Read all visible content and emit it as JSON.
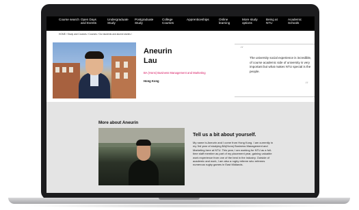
{
  "nav": {
    "items": [
      {
        "label": "Course search"
      },
      {
        "label": "Open Days and Events"
      },
      {
        "label": "Undergraduate Study"
      },
      {
        "label": "Postgraduate Study"
      },
      {
        "label": "College Courses"
      },
      {
        "label": "Apprenticeships"
      },
      {
        "label": "Online learning"
      },
      {
        "label": "More study options"
      },
      {
        "label": "Being at NTU"
      },
      {
        "label": "Academic Schools"
      }
    ]
  },
  "breadcrumb": "HOME / Study and Courses / Courses / Our students and alumni stories /",
  "profile": {
    "first_name": "Aneurin",
    "last_name": "Lau",
    "course": "BA (Hons) Business Management and Marketing",
    "hometown": "Hong Kong"
  },
  "quote": {
    "open_mark": "“",
    "close_mark": "”",
    "text": "The university social experience is incredible, of course academic side of university is very important but what makes NTU special is the people."
  },
  "more": {
    "title": "More about Aneurin",
    "tell_title": "Tell us a bit about yourself.",
    "bio": "My name is Aneurin and I come from Hong Kong. I am currently in my 3rd year of studying BA(Hons) Business Management and Marketing here at NTU. This year, I am working for NTU as a full-time staff member as part of my placement year, gaining valuable work experience from one of the best in the industry. Outside of academic and work, I am also a rugby referee who referees numerous rugby games in East Midlands."
  },
  "colors": {
    "nav_bg": "#000000",
    "accent": "#d6145f",
    "section_bg": "#e4e4e4"
  }
}
